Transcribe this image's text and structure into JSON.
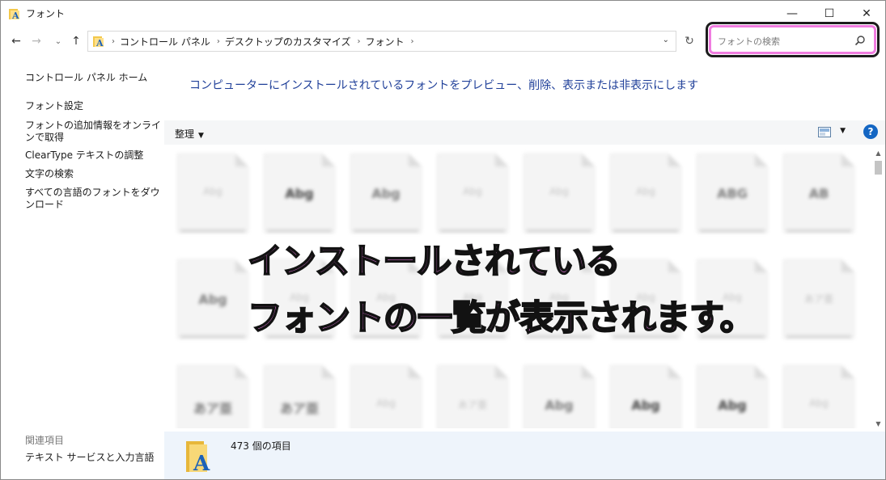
{
  "window": {
    "title": "フォント",
    "controls": {
      "minimize": "—",
      "maximize": "☐",
      "close": "✕"
    }
  },
  "navigation": {
    "back": "←",
    "forward": "→",
    "recent": "⌄",
    "up": "↑",
    "breadcrumbs": [
      "コントロール パネル",
      "デスクトップのカスタマイズ",
      "フォント"
    ],
    "separator": "›",
    "dropdown": "⌄",
    "refresh": "↻"
  },
  "search": {
    "placeholder": "フォントの検索",
    "highlight_color": "#f07ce0"
  },
  "sidebar": {
    "items": [
      {
        "label": "コントロール パネル ホーム"
      },
      {
        "label": "フォント設定"
      },
      {
        "label": "フォントの追加情報をオンラインで取得"
      },
      {
        "label": "ClearType テキストの調整"
      },
      {
        "label": "文字の検索"
      },
      {
        "label": "すべての言語のフォントをダウンロード"
      }
    ],
    "related_heading": "関連項目",
    "related_items": [
      {
        "label": "テキスト サービスと入力言語"
      }
    ]
  },
  "main": {
    "heading": "コンピューターにインストールされているフォントをプレビュー、削除、表示または非表示にします",
    "toolbar": {
      "organize": "整理",
      "dropdown": "▼",
      "help": "?"
    },
    "font_tiles": [
      {
        "glyph": "Abg",
        "style": "light"
      },
      {
        "glyph": "Abg",
        "style": "dark"
      },
      {
        "glyph": "Abg",
        "style": "normal"
      },
      {
        "glyph": "Abg",
        "style": "light"
      },
      {
        "glyph": "Abg",
        "style": "light"
      },
      {
        "glyph": "Abg",
        "style": "light"
      },
      {
        "glyph": "ABG",
        "style": "normal"
      },
      {
        "glyph": "AB",
        "style": "normal"
      },
      {
        "glyph": "Abg",
        "style": "normal"
      },
      {
        "glyph": "Abg",
        "style": "light"
      },
      {
        "glyph": "Abg",
        "style": "light"
      },
      {
        "glyph": "Abg",
        "style": "light"
      },
      {
        "glyph": "Abg",
        "style": "light"
      },
      {
        "glyph": "Abg",
        "style": "light"
      },
      {
        "glyph": "Abg",
        "style": "light"
      },
      {
        "glyph": "あア亜",
        "style": "light"
      },
      {
        "glyph": "あア亜",
        "style": "normal"
      },
      {
        "glyph": "あア亜",
        "style": "normal"
      },
      {
        "glyph": "Abg",
        "style": "light"
      },
      {
        "glyph": "あア亜",
        "style": "light"
      },
      {
        "glyph": "Abg",
        "style": "normal"
      },
      {
        "glyph": "Abg",
        "style": "dark"
      },
      {
        "glyph": "Abg",
        "style": "dark"
      },
      {
        "glyph": "Abg",
        "style": "light"
      }
    ],
    "status": {
      "item_count": "473 個の項目"
    }
  },
  "caption": {
    "line1": "インストールされている",
    "line2": "フォントの一覧が表示されます。",
    "color": "#ef7de6"
  }
}
